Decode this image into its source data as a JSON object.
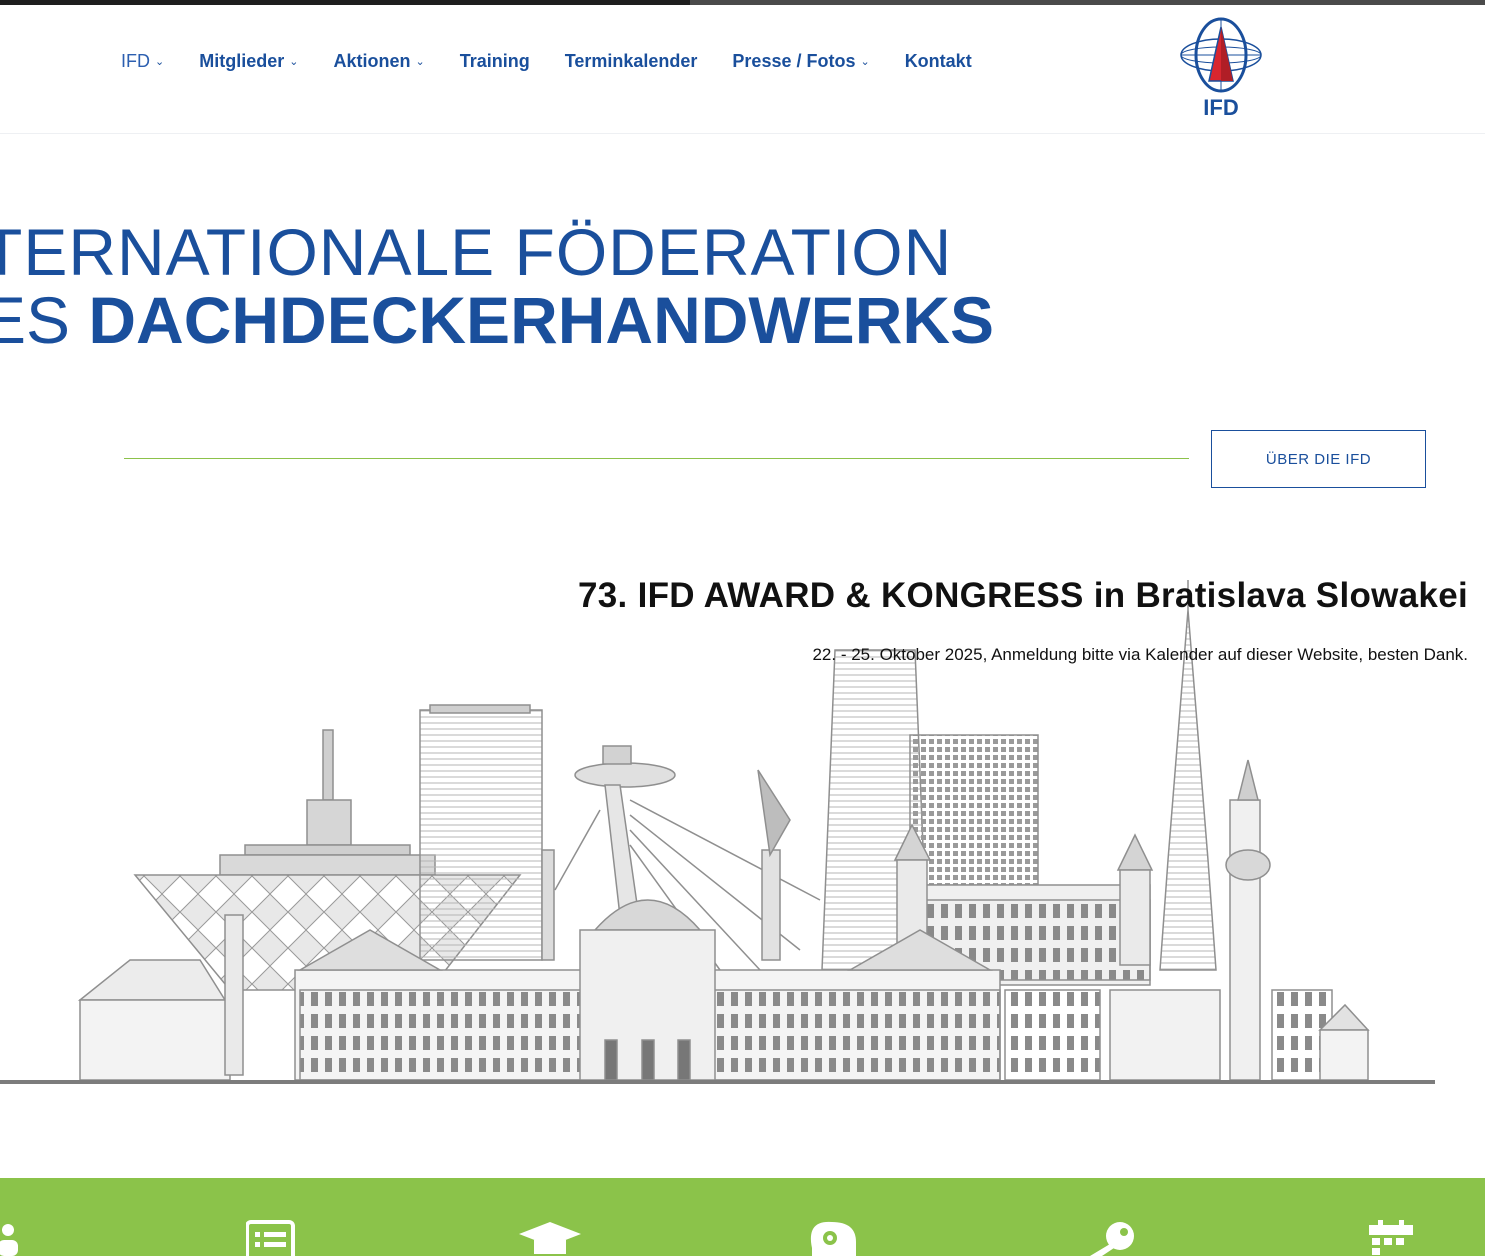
{
  "nav": {
    "items": [
      {
        "label": "IFD",
        "dropdown": true
      },
      {
        "label": "Mitglieder",
        "dropdown": true
      },
      {
        "label": "Aktionen",
        "dropdown": true
      },
      {
        "label": "Training",
        "dropdown": false
      },
      {
        "label": "Terminkalender",
        "dropdown": false
      },
      {
        "label": "Presse / Fotos",
        "dropdown": true
      },
      {
        "label": "Kontakt",
        "dropdown": false
      }
    ]
  },
  "logo": {
    "text": "IFD"
  },
  "hero": {
    "line1": "TERNATIONALE FÖDERATION",
    "line2_light": "ES ",
    "line2_bold": "DACHDECKERHANDWERKS"
  },
  "about_button": {
    "label": "ÜBER DIE IFD"
  },
  "event": {
    "title": "73. IFD AWARD & KONGRESS in Bratislava Slowakei",
    "subtitle": "22. - 25. Oktober 2025, Anmeldung bitte via Kalender auf dieser Website, besten Dank."
  },
  "colors": {
    "brand_blue": "#1a4f9c",
    "accent_green": "#8bc34a",
    "logo_red": "#d8262f"
  },
  "feature_icons": [
    "person-icon",
    "list-icon",
    "graduation-cap-icon",
    "brain-gear-icon",
    "key-icon",
    "calendar-icon"
  ]
}
